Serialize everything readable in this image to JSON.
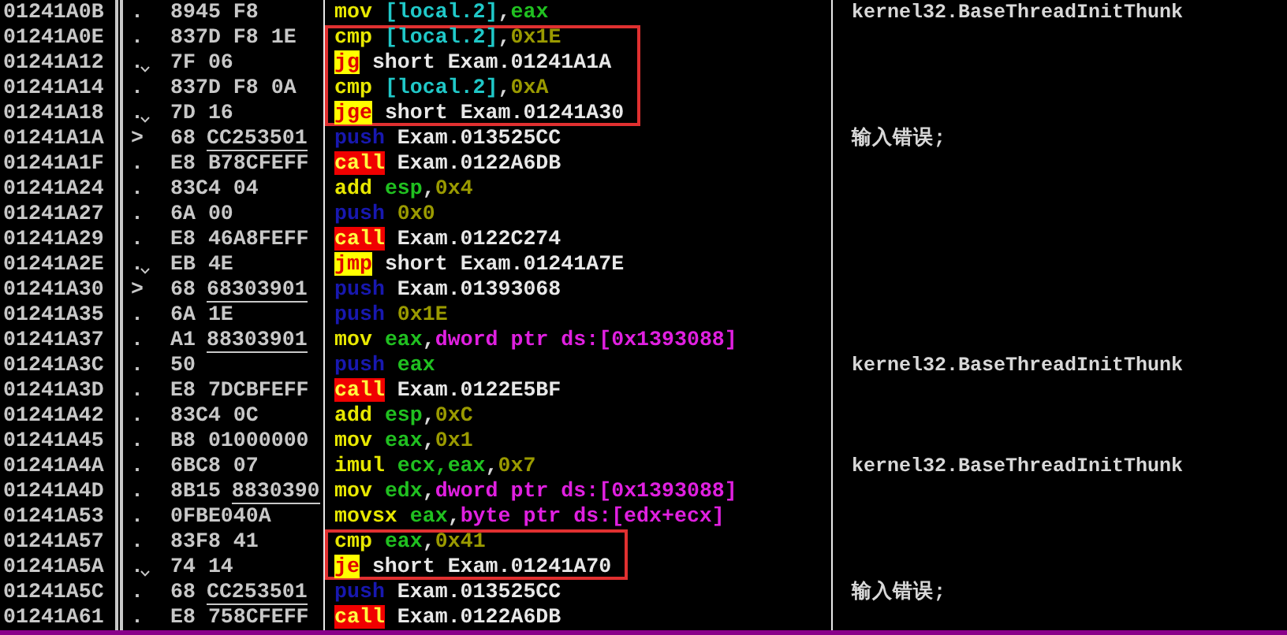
{
  "disassembly": {
    "rows": [
      {
        "address": "01241A0B",
        "highlighted": false,
        "marker": ".",
        "jump_down": false,
        "hex": "8945 F8",
        "mnemonic": "mov",
        "kind": "plain",
        "operands": [
          {
            "kind": "local",
            "text": "[local.2]"
          },
          {
            "kind": "punct",
            "text": ","
          },
          {
            "kind": "reg",
            "text": "eax"
          }
        ],
        "comment": "kernel32.BaseThreadInitThunk"
      },
      {
        "address": "01241A0E",
        "highlighted": true,
        "marker": ".",
        "jump_down": false,
        "hex": "837D F8 1E",
        "mnemonic": "cmp",
        "kind": "plain",
        "operands": [
          {
            "kind": "local",
            "text": "[local.2]"
          },
          {
            "kind": "punct",
            "text": ","
          },
          {
            "kind": "num",
            "text": "0x1E"
          }
        ]
      },
      {
        "address": "01241A12",
        "highlighted": true,
        "marker": ".",
        "jump_down": true,
        "hex": "7F 06",
        "mnemonic": "jg",
        "kind": "jump",
        "operands": [
          {
            "kind": "label",
            "text": "short Exam.01241A1A"
          }
        ]
      },
      {
        "address": "01241A14",
        "highlighted": true,
        "marker": ".",
        "jump_down": false,
        "hex": "837D F8 0A",
        "mnemonic": "cmp",
        "kind": "plain",
        "operands": [
          {
            "kind": "local",
            "text": "[local.2]"
          },
          {
            "kind": "punct",
            "text": ","
          },
          {
            "kind": "num",
            "text": "0xA"
          }
        ]
      },
      {
        "address": "01241A18",
        "highlighted": true,
        "marker": ".",
        "jump_down": true,
        "hex": "7D 16",
        "mnemonic": "jge",
        "kind": "jump",
        "operands": [
          {
            "kind": "label",
            "text": "short Exam.01241A30"
          }
        ]
      },
      {
        "address": "01241A1A",
        "highlighted": false,
        "marker": ">",
        "jump_down": false,
        "hex": "68",
        "fixup": "CC253501",
        "mnemonic": "push",
        "kind": "push",
        "operands": [
          {
            "kind": "label",
            "text": "Exam.013525CC"
          }
        ],
        "comment": "输入错误;"
      },
      {
        "address": "01241A1F",
        "highlighted": false,
        "marker": ".",
        "jump_down": false,
        "hex": "E8 B78CFEFF",
        "mnemonic": "call",
        "kind": "call",
        "operands": [
          {
            "kind": "label",
            "text": "Exam.0122A6DB"
          }
        ]
      },
      {
        "address": "01241A24",
        "highlighted": false,
        "marker": ".",
        "jump_down": false,
        "hex": "83C4 04",
        "mnemonic": "add",
        "kind": "plain",
        "operands": [
          {
            "kind": "reg",
            "text": "esp"
          },
          {
            "kind": "punct",
            "text": ","
          },
          {
            "kind": "num",
            "text": "0x4"
          }
        ]
      },
      {
        "address": "01241A27",
        "highlighted": false,
        "marker": ".",
        "jump_down": false,
        "hex": "6A 00",
        "mnemonic": "push",
        "kind": "push",
        "operands": [
          {
            "kind": "num",
            "text": "0x0"
          }
        ]
      },
      {
        "address": "01241A29",
        "highlighted": false,
        "marker": ".",
        "jump_down": false,
        "hex": "E8 46A8FEFF",
        "mnemonic": "call",
        "kind": "call",
        "operands": [
          {
            "kind": "label",
            "text": "Exam.0122C274"
          }
        ]
      },
      {
        "address": "01241A2E",
        "highlighted": false,
        "marker": ".",
        "jump_down": true,
        "hex": "EB 4E",
        "mnemonic": "jmp",
        "kind": "jump",
        "operands": [
          {
            "kind": "label",
            "text": "short Exam.01241A7E"
          }
        ]
      },
      {
        "address": "01241A30",
        "highlighted": false,
        "marker": ">",
        "jump_down": false,
        "hex": "68",
        "fixup": "68303901",
        "mnemonic": "push",
        "kind": "push",
        "operands": [
          {
            "kind": "label",
            "text": "Exam.01393068"
          }
        ]
      },
      {
        "address": "01241A35",
        "highlighted": false,
        "marker": ".",
        "jump_down": false,
        "hex": "6A 1E",
        "mnemonic": "push",
        "kind": "push",
        "operands": [
          {
            "kind": "num",
            "text": "0x1E"
          }
        ]
      },
      {
        "address": "01241A37",
        "highlighted": false,
        "marker": ".",
        "jump_down": false,
        "hex": "A1",
        "fixup": "88303901",
        "mnemonic": "mov",
        "kind": "plain",
        "operands": [
          {
            "kind": "reg",
            "text": "eax"
          },
          {
            "kind": "punct",
            "text": ","
          },
          {
            "kind": "mem",
            "text": "dword ptr ds:[0x1393088]"
          }
        ]
      },
      {
        "address": "01241A3C",
        "highlighted": false,
        "marker": ".",
        "jump_down": false,
        "hex": "50",
        "mnemonic": "push",
        "kind": "push",
        "operands": [
          {
            "kind": "reg",
            "text": "eax"
          }
        ],
        "comment": "kernel32.BaseThreadInitThunk"
      },
      {
        "address": "01241A3D",
        "highlighted": false,
        "marker": ".",
        "jump_down": false,
        "hex": "E8 7DCBFEFF",
        "mnemonic": "call",
        "kind": "call",
        "operands": [
          {
            "kind": "label",
            "text": "Exam.0122E5BF"
          }
        ]
      },
      {
        "address": "01241A42",
        "highlighted": false,
        "marker": ".",
        "jump_down": false,
        "hex": "83C4 0C",
        "mnemonic": "add",
        "kind": "plain",
        "operands": [
          {
            "kind": "reg",
            "text": "esp"
          },
          {
            "kind": "punct",
            "text": ","
          },
          {
            "kind": "num",
            "text": "0xC"
          }
        ]
      },
      {
        "address": "01241A45",
        "highlighted": false,
        "marker": ".",
        "jump_down": false,
        "hex": "B8 01000000",
        "mnemonic": "mov",
        "kind": "plain",
        "operands": [
          {
            "kind": "reg",
            "text": "eax"
          },
          {
            "kind": "punct",
            "text": ","
          },
          {
            "kind": "num",
            "text": "0x1"
          }
        ]
      },
      {
        "address": "01241A4A",
        "highlighted": false,
        "marker": ".",
        "jump_down": false,
        "hex": "6BC8 07",
        "mnemonic": "imul",
        "kind": "plain",
        "operands": [
          {
            "kind": "reg",
            "text": "ecx,eax"
          },
          {
            "kind": "punct",
            "text": ","
          },
          {
            "kind": "num",
            "text": "0x7"
          }
        ],
        "comment": "kernel32.BaseThreadInitThunk"
      },
      {
        "address": "01241A4D",
        "highlighted": false,
        "marker": ".",
        "jump_down": false,
        "hex": "8B15",
        "fixup": "8830390",
        "mnemonic": "mov",
        "kind": "plain",
        "operands": [
          {
            "kind": "reg",
            "text": "edx"
          },
          {
            "kind": "punct",
            "text": ","
          },
          {
            "kind": "mem",
            "text": "dword ptr ds:[0x1393088]"
          }
        ]
      },
      {
        "address": "01241A53",
        "highlighted": false,
        "marker": ".",
        "jump_down": false,
        "hex": "0FBE040A",
        "mnemonic": "movsx",
        "kind": "plain",
        "operands": [
          {
            "kind": "reg",
            "text": "eax"
          },
          {
            "kind": "punct",
            "text": ","
          },
          {
            "kind": "mem",
            "text": "byte ptr ds:[edx+ecx]"
          }
        ]
      },
      {
        "address": "01241A57",
        "highlighted": true,
        "marker": ".",
        "jump_down": false,
        "hex": "83F8 41",
        "mnemonic": "cmp",
        "kind": "plain",
        "operands": [
          {
            "kind": "reg",
            "text": "eax"
          },
          {
            "kind": "punct",
            "text": ","
          },
          {
            "kind": "num",
            "text": "0x41"
          }
        ]
      },
      {
        "address": "01241A5A",
        "highlighted": true,
        "marker": ".",
        "jump_down": true,
        "hex": "74 14",
        "mnemonic": "je",
        "kind": "jump",
        "operands": [
          {
            "kind": "label",
            "text": "short Exam.01241A70"
          }
        ]
      },
      {
        "address": "01241A5C",
        "highlighted": false,
        "marker": ".",
        "jump_down": false,
        "hex": "68",
        "fixup": "CC253501",
        "mnemonic": "push",
        "kind": "push",
        "operands": [
          {
            "kind": "label",
            "text": "Exam.013525CC"
          }
        ],
        "comment": "输入错误;"
      },
      {
        "address": "01241A61",
        "highlighted": false,
        "marker": ".",
        "jump_down": false,
        "hex": "E8 758CFEFF",
        "mnemonic": "call",
        "kind": "call",
        "operands": [
          {
            "kind": "label",
            "text": "Exam.0122A6DB"
          }
        ]
      }
    ]
  }
}
